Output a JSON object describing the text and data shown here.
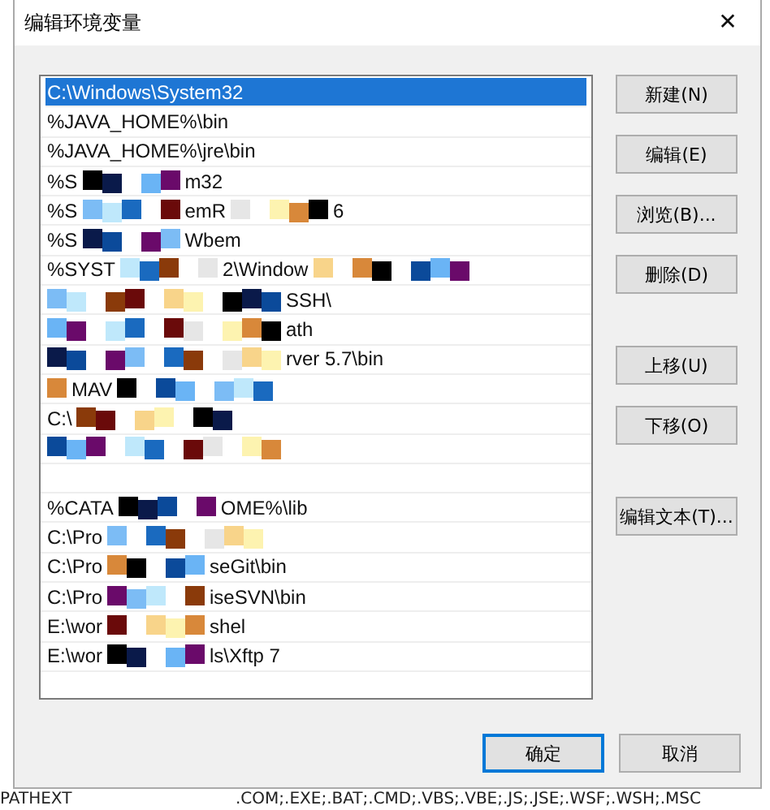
{
  "background_window": {
    "bottom_row": {
      "name": "PATHEXT",
      "value": ".COM;.EXE;.BAT;.CMD;.VBS;.VBE;.JS;.JSE;.WSF;.WSH;.MSC"
    }
  },
  "window": {
    "title": "编辑环境变量",
    "close": "✕"
  },
  "list": {
    "rows": [
      {
        "selected": true,
        "segments": [
          {
            "kind": "text",
            "text": "C:\\Windows\\System32"
          }
        ]
      },
      {
        "selected": false,
        "segments": [
          {
            "kind": "text",
            "text": "%JAVA_HOME%\\bin"
          }
        ]
      },
      {
        "selected": false,
        "segments": [
          {
            "kind": "text",
            "text": "%JAVA_HOME%\\jre\\bin"
          }
        ]
      },
      {
        "selected": false,
        "segments": [
          {
            "kind": "text",
            "text": "%S"
          },
          {
            "kind": "mosaic"
          },
          {
            "kind": "text",
            "text": "m32"
          }
        ]
      },
      {
        "selected": false,
        "segments": [
          {
            "kind": "text",
            "text": "%S"
          },
          {
            "kind": "mosaic"
          },
          {
            "kind": "text",
            "text": "emR"
          },
          {
            "kind": "mosaic"
          },
          {
            "kind": "text",
            "text": "6"
          }
        ]
      },
      {
        "selected": false,
        "segments": [
          {
            "kind": "text",
            "text": "%S"
          },
          {
            "kind": "mosaic"
          },
          {
            "kind": "text",
            "text": "Wbem"
          }
        ]
      },
      {
        "selected": false,
        "segments": [
          {
            "kind": "text",
            "text": "%SYST"
          },
          {
            "kind": "mosaic"
          },
          {
            "kind": "text",
            "text": "2\\Window"
          },
          {
            "kind": "mosaic"
          }
        ]
      },
      {
        "selected": false,
        "segments": [
          {
            "kind": "mosaic"
          },
          {
            "kind": "text",
            "text": "SSH\\"
          }
        ]
      },
      {
        "selected": false,
        "segments": [
          {
            "kind": "mosaic"
          },
          {
            "kind": "text",
            "text": "ath"
          }
        ]
      },
      {
        "selected": false,
        "segments": [
          {
            "kind": "mosaic"
          },
          {
            "kind": "text",
            "text": "rver 5.7\\bin"
          }
        ]
      },
      {
        "selected": false,
        "segments": [
          {
            "kind": "mosaic"
          },
          {
            "kind": "text",
            "text": "MAV"
          },
          {
            "kind": "mosaic"
          }
        ]
      },
      {
        "selected": false,
        "segments": [
          {
            "kind": "text",
            "text": "C:\\"
          },
          {
            "kind": "mosaic"
          }
        ]
      },
      {
        "selected": false,
        "segments": [
          {
            "kind": "mosaic"
          }
        ]
      },
      {
        "selected": false,
        "segments": []
      },
      {
        "selected": false,
        "segments": [
          {
            "kind": "text",
            "text": "%CATA"
          },
          {
            "kind": "mosaic"
          },
          {
            "kind": "text",
            "text": "OME%\\lib"
          }
        ]
      },
      {
        "selected": false,
        "segments": [
          {
            "kind": "text",
            "text": "C:\\Pro"
          },
          {
            "kind": "mosaic"
          }
        ]
      },
      {
        "selected": false,
        "segments": [
          {
            "kind": "text",
            "text": "C:\\Pro"
          },
          {
            "kind": "mosaic"
          },
          {
            "kind": "text",
            "text": "seGit\\bin"
          }
        ]
      },
      {
        "selected": false,
        "segments": [
          {
            "kind": "text",
            "text": "C:\\Pro"
          },
          {
            "kind": "mosaic"
          },
          {
            "kind": "text",
            "text": "iseSVN\\bin"
          }
        ]
      },
      {
        "selected": false,
        "segments": [
          {
            "kind": "text",
            "text": "E:\\wor"
          },
          {
            "kind": "mosaic"
          },
          {
            "kind": "text",
            "text": "shel"
          }
        ]
      },
      {
        "selected": false,
        "segments": [
          {
            "kind": "text",
            "text": "E:\\wor"
          },
          {
            "kind": "mosaic"
          },
          {
            "kind": "text",
            "text": "ls\\Xftp 7"
          }
        ]
      }
    ]
  },
  "button_groups": [
    [
      "新建(N)",
      "编辑(E)",
      "浏览(B)...",
      "删除(D)"
    ],
    [
      "上移(U)",
      "下移(O)"
    ],
    [
      "编辑文本(T)..."
    ]
  ],
  "footer_buttons": [
    {
      "label": "确定",
      "default": true
    },
    {
      "label": "取消",
      "default": false
    }
  ]
}
